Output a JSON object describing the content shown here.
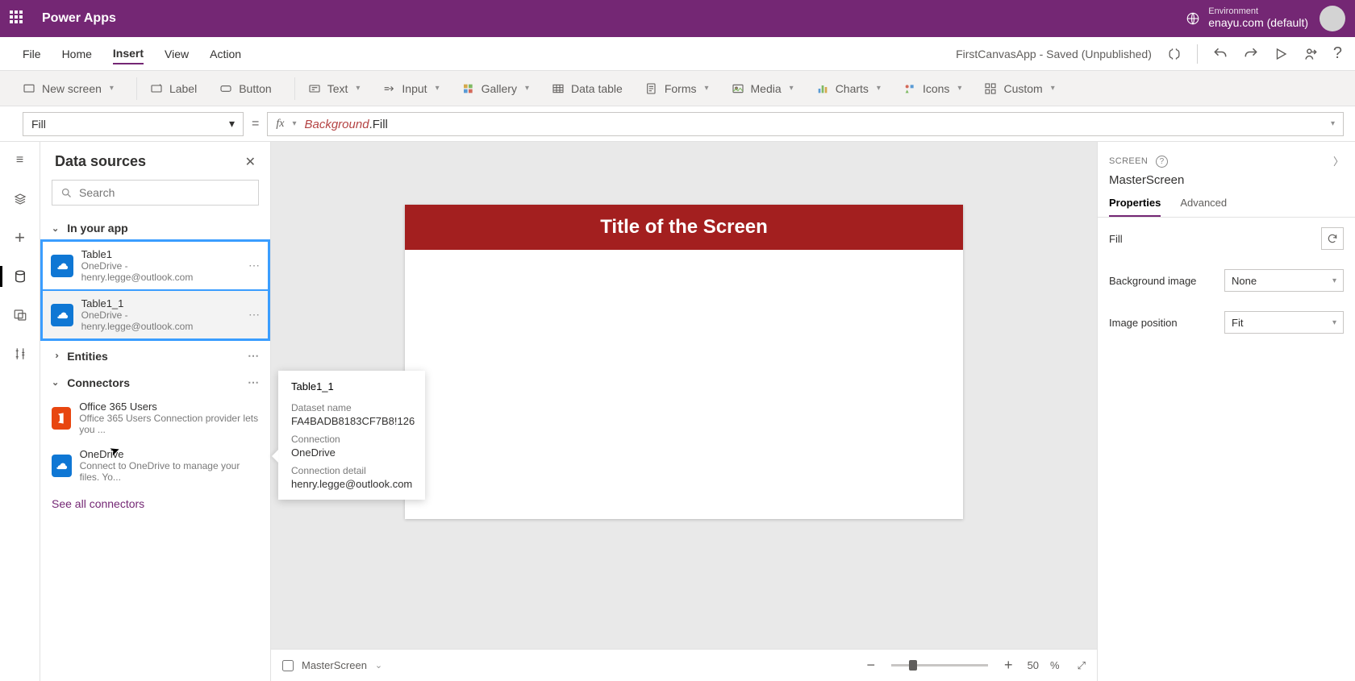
{
  "header": {
    "appTitle": "Power Apps",
    "envLabel": "Environment",
    "envValue": "enayu.com (default)"
  },
  "menuBar": {
    "items": [
      "File",
      "Home",
      "Insert",
      "View",
      "Action"
    ],
    "activeIndex": 2,
    "status": "FirstCanvasApp - Saved (Unpublished)"
  },
  "ribbon": {
    "newScreen": "New screen",
    "label": "Label",
    "button": "Button",
    "text": "Text",
    "input": "Input",
    "gallery": "Gallery",
    "dataTable": "Data table",
    "forms": "Forms",
    "media": "Media",
    "charts": "Charts",
    "icons": "Icons",
    "custom": "Custom"
  },
  "formulaBar": {
    "property": "Fill",
    "fxLabel": "fx",
    "obj": "Background",
    "prop": ".Fill"
  },
  "dataPanel": {
    "title": "Data sources",
    "searchPlaceholder": "Search",
    "sections": {
      "inYourApp": "In your app",
      "entities": "Entities",
      "connectors": "Connectors"
    },
    "dsItems": [
      {
        "name": "Table1",
        "sub": "OneDrive - henry.legge@outlook.com"
      },
      {
        "name": "Table1_1",
        "sub": "OneDrive - henry.legge@outlook.com"
      }
    ],
    "connectors": [
      {
        "name": "Office 365 Users",
        "sub": "Office 365 Users Connection provider lets you ...",
        "color": "#e84610"
      },
      {
        "name": "OneDrive",
        "sub": "Connect to OneDrive to manage your files. Yo...",
        "color": "#0f77d4"
      }
    ],
    "seeAll": "See all connectors"
  },
  "tooltip": {
    "title": "Table1_1",
    "l1": "Dataset name",
    "v1": "FA4BADB8183CF7B8!126",
    "l2": "Connection",
    "v2": "OneDrive",
    "l3": "Connection detail",
    "v3": "henry.legge@outlook.com"
  },
  "canvas": {
    "screenTitle": "Title of the Screen",
    "footerName": "MasterScreen",
    "zoom": "50",
    "zoomSuffix": "%"
  },
  "properties": {
    "sectionLabel": "SCREEN",
    "screenName": "MasterScreen",
    "tabs": [
      "Properties",
      "Advanced"
    ],
    "activeTab": 0,
    "rows": {
      "fill": "Fill",
      "bgImage": "Background image",
      "bgImageVal": "None",
      "imgPos": "Image position",
      "imgPosVal": "Fit"
    }
  }
}
